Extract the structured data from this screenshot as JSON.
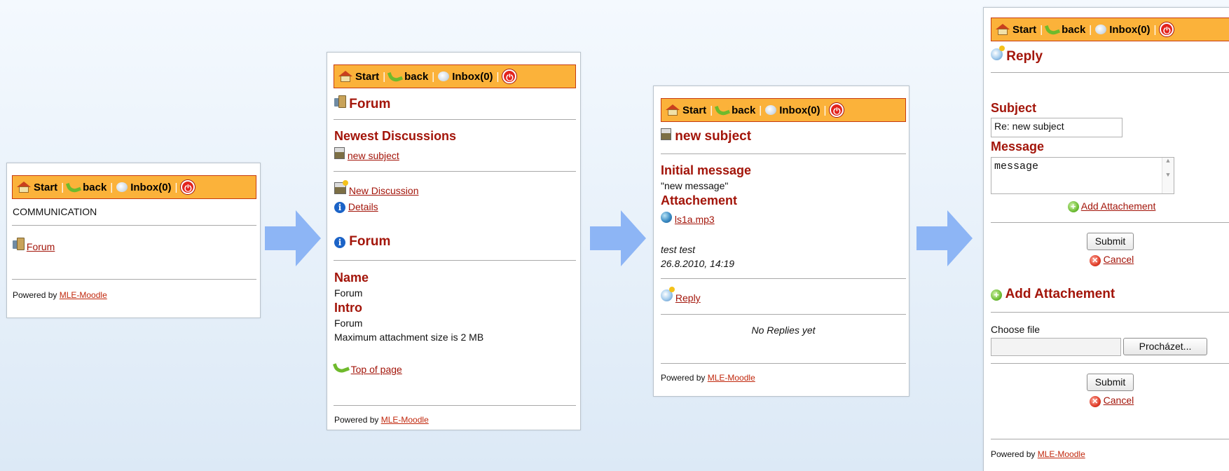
{
  "nav": {
    "start": "Start",
    "back": "back",
    "inbox": "Inbox(0)",
    "sep": "|",
    "logout_symbol": "⏻"
  },
  "footer": {
    "powered_by": "Powered by",
    "link": "MLE-Moodle"
  },
  "screen1": {
    "communication": "COMMUNICATION",
    "forum_link": "Forum"
  },
  "screen2": {
    "title": "Forum",
    "newest_discussions": "Newest Discussions",
    "discussion_link": "new subject",
    "new_discussion": "New Discussion",
    "details": "Details",
    "forum_heading": "Forum",
    "name_label": "Name",
    "name_value": "Forum",
    "intro_label": "Intro",
    "intro_value": "Forum",
    "max_attachment": "Maximum attachment size is 2 MB",
    "top_of_page": "Top of page"
  },
  "screen3": {
    "title": "new subject",
    "initial_message_label": "Initial message",
    "initial_message_value": "\"new message\"",
    "attachment_label": "Attachement",
    "attachment_file": "ls1a.mp3",
    "author": "test test",
    "date": "26.8.2010, 14:19",
    "reply": "Reply",
    "no_replies": "No Replies yet"
  },
  "screen4": {
    "title": "Reply",
    "subject_label": "Subject",
    "subject_value": "Re: new subject",
    "message_label": "Message",
    "message_value": "message",
    "add_attachment_link": "Add Attachement",
    "submit": "Submit",
    "cancel": "Cancel",
    "add_attachment_heading": "Add Attachement",
    "choose_file": "Choose file",
    "browse": "Procházet...",
    "submit2": "Submit",
    "cancel2": "Cancel"
  },
  "colors": {
    "navbar_bg": "#fbb23a",
    "heading": "#a3150a",
    "arrow": "#8db5f5"
  }
}
